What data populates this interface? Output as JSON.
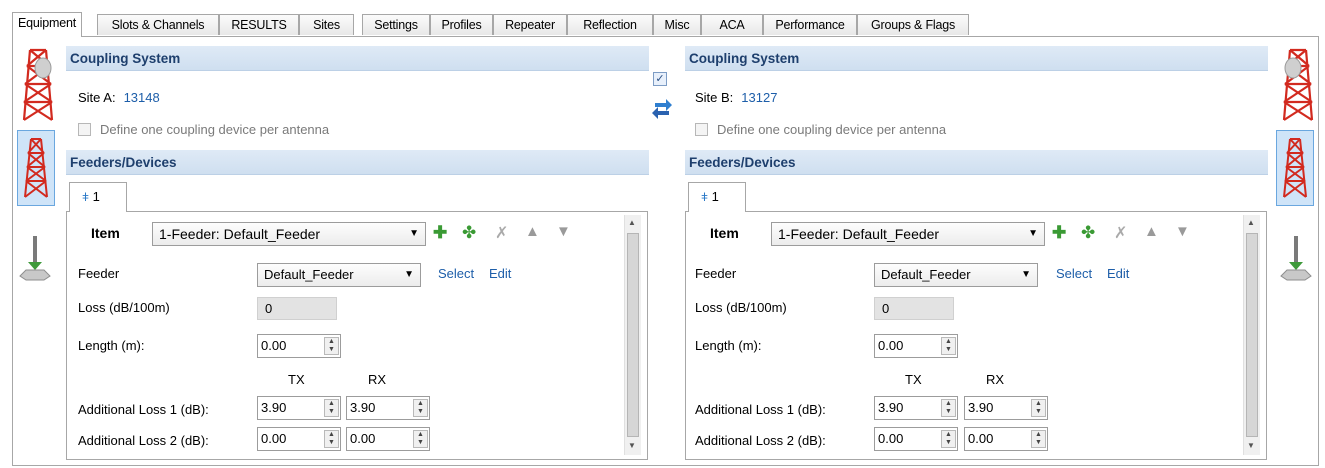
{
  "tabs": [
    "Equipment",
    "Slots & Channels",
    "RESULTS",
    "Sites",
    "Settings",
    "Profiles",
    "Repeater",
    "Reflection",
    "Misc",
    "ACA",
    "Performance",
    "Groups & Flags"
  ],
  "active_tab": "Equipment",
  "sides": {
    "a": {
      "coupling_header": "Coupling System",
      "site_label": "Site A:",
      "site_value": "13148",
      "define_label": "Define one coupling device per antenna",
      "feeders_header": "Feeders/Devices",
      "subtab": "1",
      "item_label": "Item",
      "item_value": "1-Feeder: Default_Feeder",
      "feeder_label": "Feeder",
      "feeder_value": "Default_Feeder",
      "select": "Select",
      "edit": "Edit",
      "loss_label": "Loss (dB/100m)",
      "loss_value": "0",
      "length_label": "Length (m):",
      "length_value": "0.00",
      "tx": "TX",
      "rx": "RX",
      "add1_label": "Additional Loss 1 (dB):",
      "add1_tx": "3.90",
      "add1_rx": "3.90",
      "add2_label": "Additional Loss 2 (dB):",
      "add2_tx": "0.00",
      "add2_rx": "0.00"
    },
    "b": {
      "coupling_header": "Coupling System",
      "site_label": "Site B:",
      "site_value": "13127",
      "define_label": "Define one coupling device per antenna",
      "feeders_header": "Feeders/Devices",
      "subtab": "1",
      "item_label": "Item",
      "item_value": "1-Feeder: Default_Feeder",
      "feeder_label": "Feeder",
      "feeder_value": "Default_Feeder",
      "select": "Select",
      "edit": "Edit",
      "loss_label": "Loss (dB/100m)",
      "loss_value": "0",
      "length_label": "Length (m):",
      "length_value": "0.00",
      "tx": "TX",
      "rx": "RX",
      "add1_label": "Additional Loss 1 (dB):",
      "add1_tx": "3.90",
      "add1_rx": "3.90",
      "add2_label": "Additional Loss 2 (dB):",
      "add2_tx": "0.00",
      "add2_rx": "0.00"
    }
  },
  "icons": {
    "tower_with_dish": "tower-with-dish-icon",
    "tower_selected": "tower-icon",
    "antenna": "antenna-icon",
    "sync_checkbox": "checked",
    "swap": "swap-arrows-icon"
  },
  "colors": {
    "header_text": "#1e3f6d",
    "header_bg": "#d6e4f3",
    "link": "#1d5ea9",
    "tower": "#d22a1f"
  }
}
